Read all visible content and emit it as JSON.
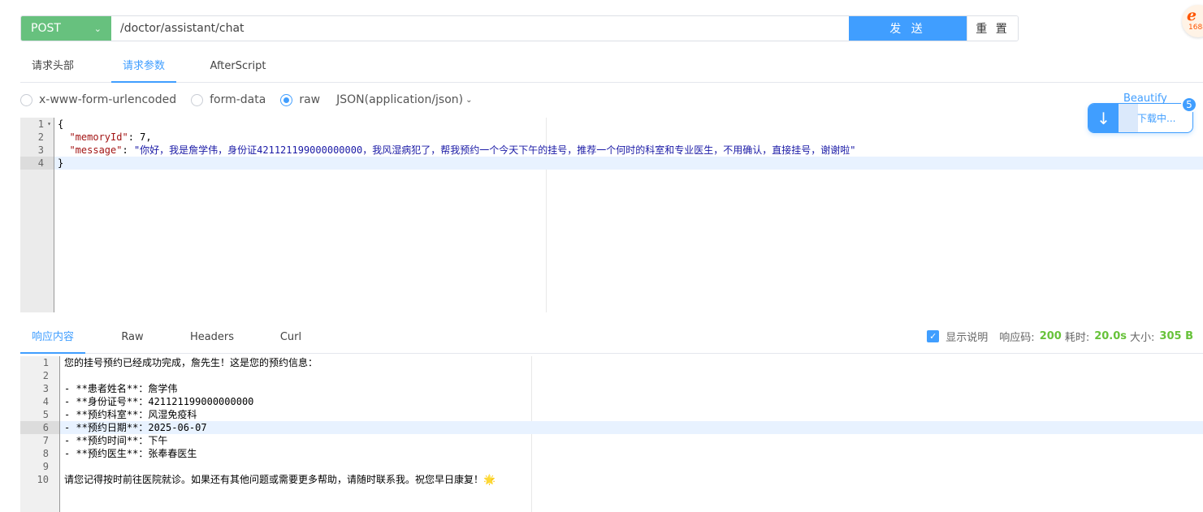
{
  "request": {
    "method": "POST",
    "url": "/doctor/assistant/chat",
    "send_label": "发 送",
    "reset_label": "重 置"
  },
  "request_tabs": [
    "请求头部",
    "请求参数",
    "AfterScript"
  ],
  "active_request_tab": "请求参数",
  "body_types": {
    "urlencoded": "x-www-form-urlencoded",
    "formdata": "form-data",
    "raw": "raw",
    "selected": "raw",
    "content_type": "JSON(application/json)",
    "beautify_label": "Beautify"
  },
  "download": {
    "label": "下载中...",
    "badge": "5"
  },
  "corner_logo": {
    "text": "e",
    "sub": "1688"
  },
  "request_body": {
    "line_numbers": [
      "1",
      "2",
      "3",
      "4"
    ],
    "active_line": 4,
    "lines": {
      "l1": "{",
      "l2_key": "\"memoryId\"",
      "l2_sep": ": ",
      "l2_val": "7,",
      "l3_key": "\"message\"",
      "l3_sep": ": ",
      "l3_val": "\"你好，我是詹学伟，身份证421121199000000000，我风湿病犯了，帮我预约一个今天下午的挂号，推荐一个何时的科室和专业医生，不用确认，直接挂号，谢谢啦\"",
      "l4": "}"
    }
  },
  "response_tabs": [
    "响应内容",
    "Raw",
    "Headers",
    "Curl"
  ],
  "active_response_tab": "响应内容",
  "response_meta": {
    "show_desc_label": "显示说明",
    "show_desc_checked": true,
    "status_label": "响应码:",
    "status_value": "200",
    "time_label": "耗时:",
    "time_value": "20.0s",
    "size_label": "大小:",
    "size_value": "305 B"
  },
  "response_body": {
    "line_numbers": [
      "1",
      "2",
      "3",
      "4",
      "5",
      "6",
      "7",
      "8",
      "9",
      "10"
    ],
    "active_line": 6,
    "lines": [
      "您的挂号预约已经成功完成，詹先生！这是您的预约信息：",
      "",
      "- **患者姓名**：詹学伟",
      "- **身份证号**：421121199000000000",
      "- **预约科室**：风湿免疫科",
      "- **预约日期**：2025-06-07",
      "- **预约时间**：下午",
      "- **预约医生**：张奉春医生",
      "",
      "请您记得按时前往医院就诊。如果还有其他问题或需要更多帮助，请随时联系我。祝您早日康复！🌟"
    ]
  },
  "colors": {
    "method_bg": "#67c17e",
    "primary": "#409eff",
    "success": "#67c23a"
  }
}
